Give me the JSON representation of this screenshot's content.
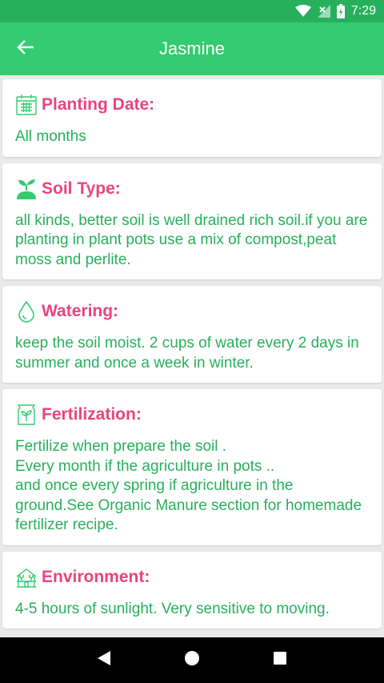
{
  "status_bar": {
    "time": "7:29"
  },
  "app_bar": {
    "title": "Jasmine"
  },
  "cards": [
    {
      "title": "Planting Date:",
      "icon": "calendar-icon",
      "body": "All months"
    },
    {
      "title": "Soil Type:",
      "icon": "sprout-icon",
      "body": "all kinds, better soil is well drained rich soil.if you are planting in plant pots use a mix of compost,peat moss and perlite."
    },
    {
      "title": "Watering:",
      "icon": "water-drop-icon",
      "body": "keep the soil moist. 2 cups of water every 2 days in summer and once a week in winter."
    },
    {
      "title": "Fertilization:",
      "icon": "fertilizer-bag-icon",
      "body": "Fertilize  when prepare the soil .\nEvery month if the agriculture in pots ..\nand once every spring if agriculture in the ground.See Organic Manure section for homemade fertilizer recipe."
    },
    {
      "title": "Environment:",
      "icon": "greenhouse-icon",
      "body": "4-5 hours of sunlight. Very sensitive to moving."
    }
  ],
  "colors": {
    "status_bar": "#27b05c",
    "app_bar": "#33cc70",
    "title_pink": "#e8457f",
    "body_green": "#27b05c"
  }
}
